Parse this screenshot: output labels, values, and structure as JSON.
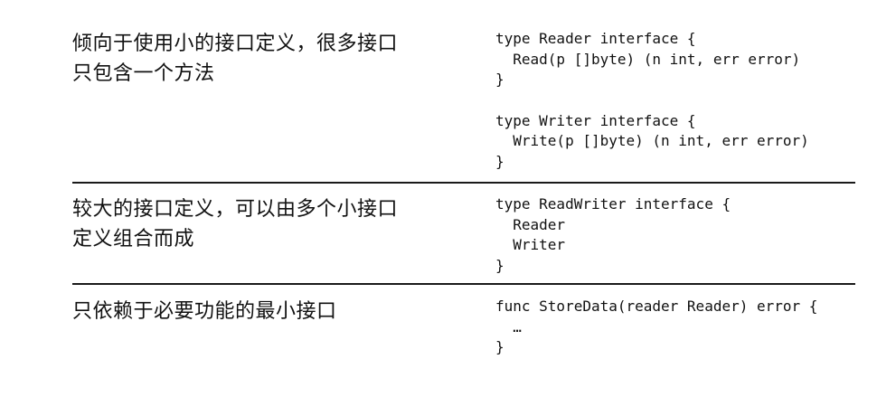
{
  "rows": [
    {
      "description": "倾向于使用小的接口定义，很多接口只包含一个方法",
      "code_blocks": [
        [
          "type Reader interface {",
          "  Read(p []byte) (n int, err error)",
          "}"
        ],
        [
          "type Writer interface {",
          "  Write(p []byte) (n int, err error)",
          "}"
        ]
      ]
    },
    {
      "description": "较大的接口定义，可以由多个小接口定义组合而成",
      "code_blocks": [
        [
          "type ReadWriter interface {",
          "  Reader",
          "  Writer",
          "}"
        ]
      ]
    },
    {
      "description": "只依赖于必要功能的最小接口",
      "code_blocks": [
        [
          "func StoreData(reader Reader) error {",
          "  …",
          "}"
        ]
      ]
    }
  ]
}
